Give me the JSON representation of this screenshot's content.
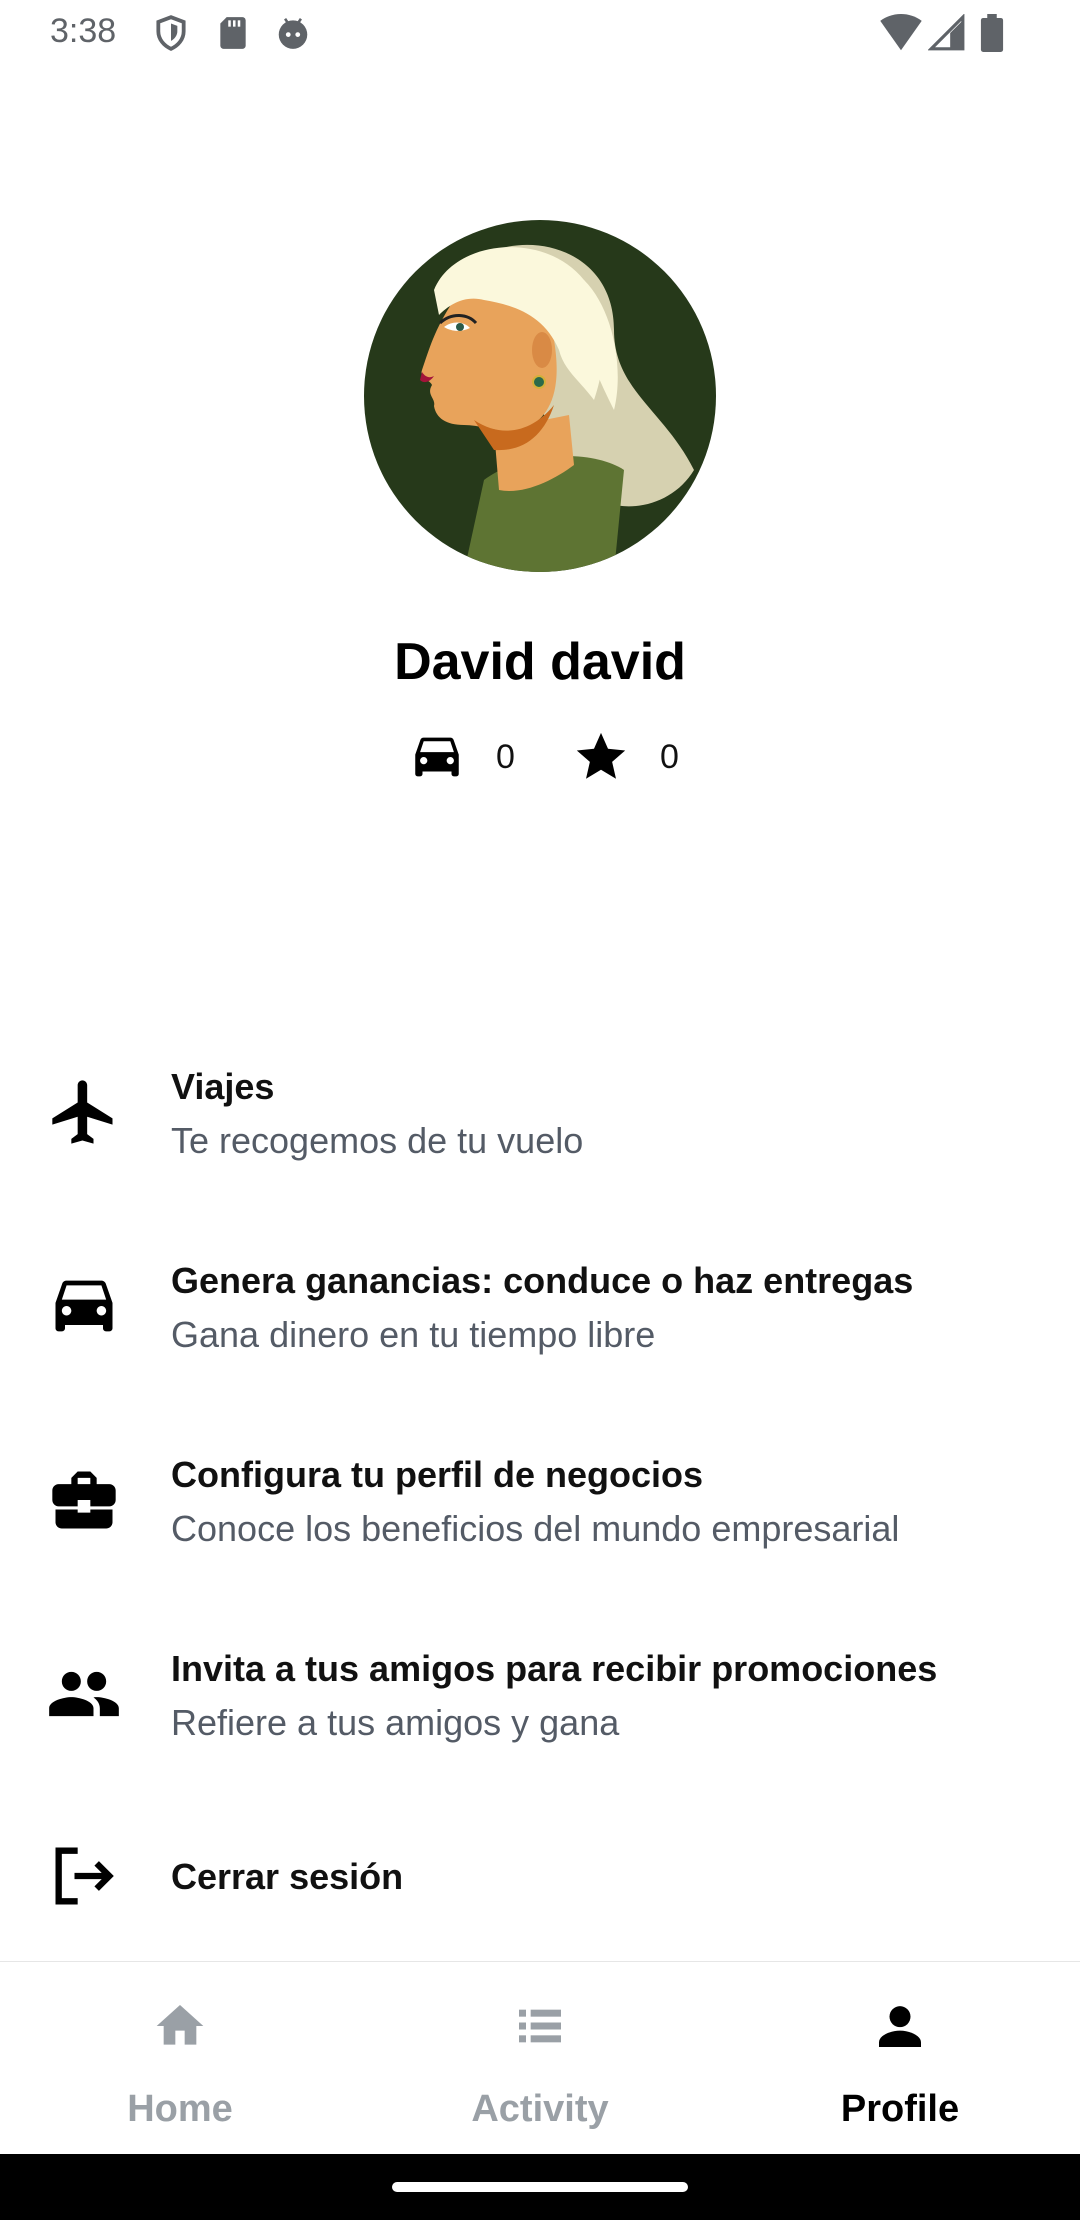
{
  "status_bar": {
    "time": "3:38",
    "left_icons": [
      "shield-icon",
      "sd-card-icon",
      "android-head-icon"
    ],
    "right_icons": [
      "wifi-icon",
      "cell-signal-icon",
      "battery-icon"
    ]
  },
  "profile": {
    "name": "David david",
    "trips_count": "0",
    "rating": "0"
  },
  "menu": [
    {
      "icon": "airplane-icon",
      "title": "Viajes",
      "subtitle": "Te recogemos de tu vuelo"
    },
    {
      "icon": "car-icon",
      "title": "Genera ganancias: conduce o haz entregas",
      "subtitle": "Gana dinero en tu tiempo libre"
    },
    {
      "icon": "briefcase-icon",
      "title": "Configura tu perfil de negocios",
      "subtitle": "Conoce los beneficios del mundo empresarial"
    },
    {
      "icon": "people-icon",
      "title": "Invita a tus amigos para recibir promociones",
      "subtitle": "Refiere a tus amigos y gana"
    },
    {
      "icon": "logout-icon",
      "title": "Cerrar sesión"
    }
  ],
  "bottom_nav": {
    "tabs": [
      {
        "icon": "home-icon",
        "label": "Home",
        "active": false
      },
      {
        "icon": "list-icon",
        "label": "Activity",
        "active": false
      },
      {
        "icon": "person-icon",
        "label": "Profile",
        "active": true
      }
    ]
  },
  "colors": {
    "text_primary": "#000000",
    "text_secondary": "#545b66",
    "nav_inactive": "#9aa0a6",
    "status_icons": "#5f6368",
    "avatar_bg": "#26391a"
  }
}
